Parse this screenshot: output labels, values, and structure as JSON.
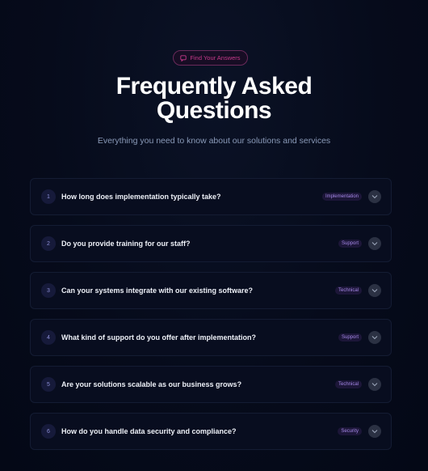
{
  "header": {
    "badge_label": "Find Your Answers",
    "badge_icon": "chat-bubble-icon",
    "title_line1": "Frequently Asked",
    "title_line2": "Questions",
    "subtitle": "Everything you need to know about our solutions and services"
  },
  "faqs": [
    {
      "number": "1",
      "question": "How long does implementation typically take?",
      "tag": "Implementation"
    },
    {
      "number": "2",
      "question": "Do you provide training for our staff?",
      "tag": "Support"
    },
    {
      "number": "3",
      "question": "Can your systems integrate with our existing software?",
      "tag": "Technical"
    },
    {
      "number": "4",
      "question": "What kind of support do you offer after implementation?",
      "tag": "Support"
    },
    {
      "number": "5",
      "question": "Are your solutions scalable as our business grows?",
      "tag": "Technical"
    },
    {
      "number": "6",
      "question": "How do you handle data security and compliance?",
      "tag": "Security"
    }
  ],
  "colors": {
    "background": "#050a1a",
    "accent_pink": "#c53a8a",
    "accent_purple": "#a487e6"
  }
}
